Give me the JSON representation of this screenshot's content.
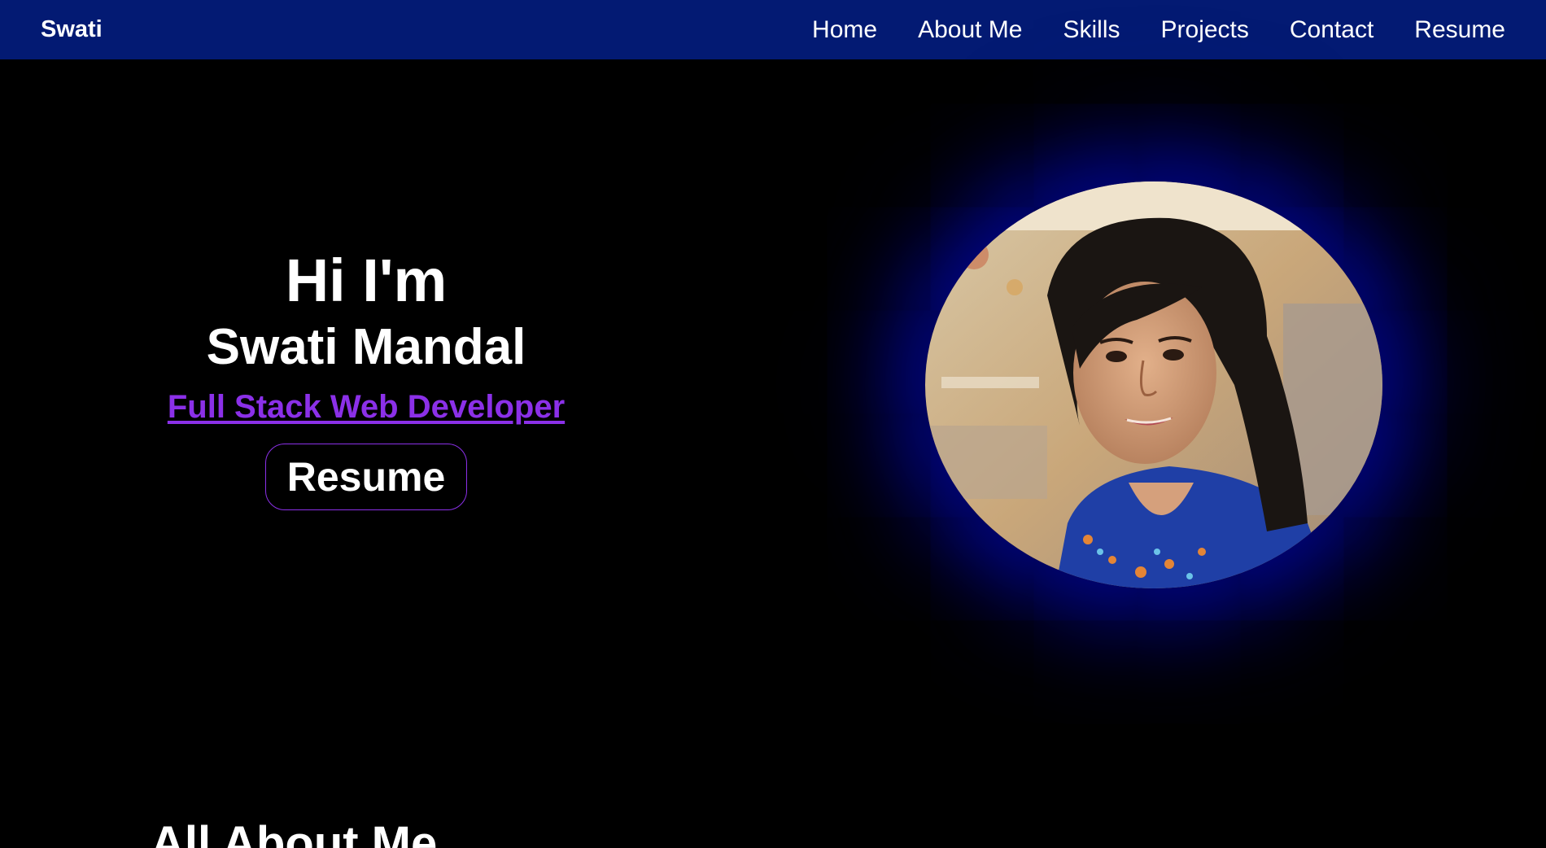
{
  "nav": {
    "brand": "Swati",
    "links": [
      "Home",
      "About Me",
      "Skills",
      "Projects",
      "Contact",
      "Resume"
    ],
    "background_color": "#031a73"
  },
  "hero": {
    "greeting": "Hi I'm",
    "name": "Swati Mandal",
    "role": "Full Stack Web Developer",
    "resume_button": "Resume",
    "accent_color": "#8b30e8",
    "photo_glow_color": "#0a14c8"
  },
  "about": {
    "title": "All About Me"
  }
}
